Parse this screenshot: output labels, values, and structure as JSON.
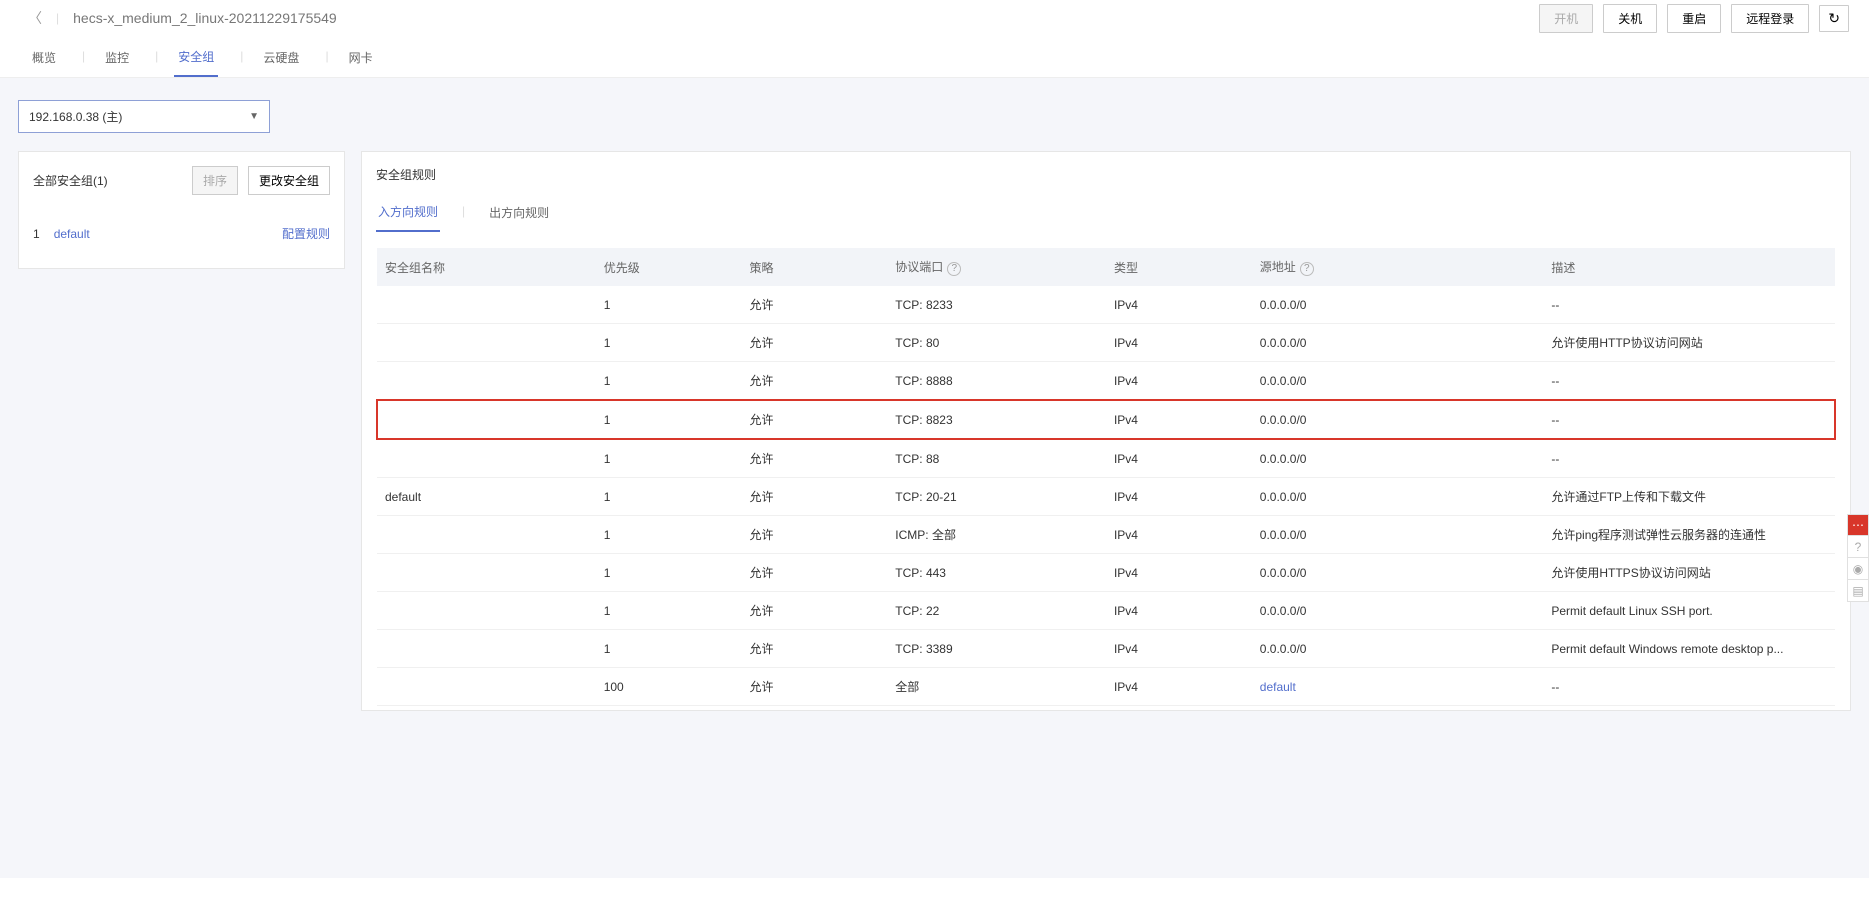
{
  "header": {
    "title": "hecs-x_medium_2_linux-20211229175549",
    "buttons": {
      "power_on": "开机",
      "power_off": "关机",
      "restart": "重启",
      "remote_login": "远程登录"
    }
  },
  "tabs": {
    "overview": "概览",
    "monitor": "监控",
    "security_group": "安全组",
    "disk": "云硬盘",
    "nic": "网卡"
  },
  "ip_selector": "192.168.0.38 (主)",
  "left_panel": {
    "title": "全部安全组(1)",
    "sort_btn": "排序",
    "change_btn": "更改安全组",
    "list": [
      {
        "index": "1",
        "name": "default",
        "config": "配置规则"
      }
    ]
  },
  "right_panel": {
    "title": "安全组规则",
    "tabs": {
      "inbound": "入方向规则",
      "outbound": "出方向规则"
    },
    "columns": {
      "name": "安全组名称",
      "priority": "优先级",
      "policy": "策略",
      "protocol": "协议端口",
      "type": "类型",
      "source": "源地址",
      "desc": "描述"
    },
    "group_name": "default",
    "rows": [
      {
        "priority": "1",
        "policy": "允许",
        "protocol": "TCP: 8233",
        "type": "IPv4",
        "source": "0.0.0.0/0",
        "desc": "--",
        "highlight": false,
        "source_link": false
      },
      {
        "priority": "1",
        "policy": "允许",
        "protocol": "TCP: 80",
        "type": "IPv4",
        "source": "0.0.0.0/0",
        "desc": "允许使用HTTP协议访问网站",
        "highlight": false,
        "source_link": false
      },
      {
        "priority": "1",
        "policy": "允许",
        "protocol": "TCP: 8888",
        "type": "IPv4",
        "source": "0.0.0.0/0",
        "desc": "--",
        "highlight": false,
        "source_link": false
      },
      {
        "priority": "1",
        "policy": "允许",
        "protocol": "TCP: 8823",
        "type": "IPv4",
        "source": "0.0.0.0/0",
        "desc": "--",
        "highlight": true,
        "source_link": false
      },
      {
        "priority": "1",
        "policy": "允许",
        "protocol": "TCP: 88",
        "type": "IPv4",
        "source": "0.0.0.0/0",
        "desc": "--",
        "highlight": false,
        "source_link": false
      },
      {
        "priority": "1",
        "policy": "允许",
        "protocol": "TCP: 20-21",
        "type": "IPv4",
        "source": "0.0.0.0/0",
        "desc": "允许通过FTP上传和下载文件",
        "highlight": false,
        "source_link": false
      },
      {
        "priority": "1",
        "policy": "允许",
        "protocol": "ICMP: 全部",
        "type": "IPv4",
        "source": "0.0.0.0/0",
        "desc": "允许ping程序测试弹性云服务器的连通性",
        "highlight": false,
        "source_link": false
      },
      {
        "priority": "1",
        "policy": "允许",
        "protocol": "TCP: 443",
        "type": "IPv4",
        "source": "0.0.0.0/0",
        "desc": "允许使用HTTPS协议访问网站",
        "highlight": false,
        "source_link": false
      },
      {
        "priority": "1",
        "policy": "允许",
        "protocol": "TCP: 22",
        "type": "IPv4",
        "source": "0.0.0.0/0",
        "desc": "Permit default Linux SSH port.",
        "highlight": false,
        "source_link": false
      },
      {
        "priority": "1",
        "policy": "允许",
        "protocol": "TCP: 3389",
        "type": "IPv4",
        "source": "0.0.0.0/0",
        "desc": "Permit default Windows remote desktop p...",
        "highlight": false,
        "source_link": false
      },
      {
        "priority": "100",
        "policy": "允许",
        "protocol": "全部",
        "type": "IPv4",
        "source": "default",
        "desc": "--",
        "highlight": false,
        "source_link": true
      }
    ]
  }
}
